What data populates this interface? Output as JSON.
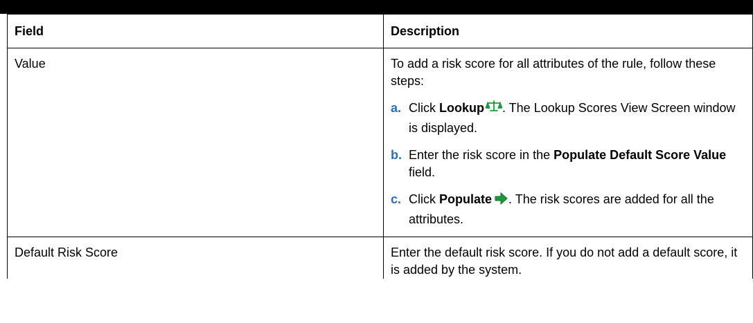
{
  "table": {
    "headers": {
      "field": "Field",
      "description": "Description"
    },
    "rows": [
      {
        "field": "Value",
        "intro": "To add a risk score for all attributes of the rule, follow these steps:",
        "steps": [
          {
            "marker": "a.",
            "pre": "Click ",
            "bold1": "Lookup",
            "icon": "scale-icon",
            "post": ". The Lookup Scores View Screen window is displayed."
          },
          {
            "marker": "b.",
            "pre": "Enter the risk score in the ",
            "bold1": "Populate Default Score Value",
            "post": " field."
          },
          {
            "marker": "c.",
            "pre": "Click ",
            "bold1": "Populate",
            "icon": "arrow-right-icon",
            "post": ". The risk scores are added for all the attributes."
          }
        ]
      },
      {
        "field": "Default Risk Score",
        "description": "Enter the default risk score. If you do not add a default score, it is added by the system."
      }
    ]
  },
  "colors": {
    "marker": "#2a6ebb",
    "icon_green": "#1a9a3a",
    "border": "#000000"
  }
}
